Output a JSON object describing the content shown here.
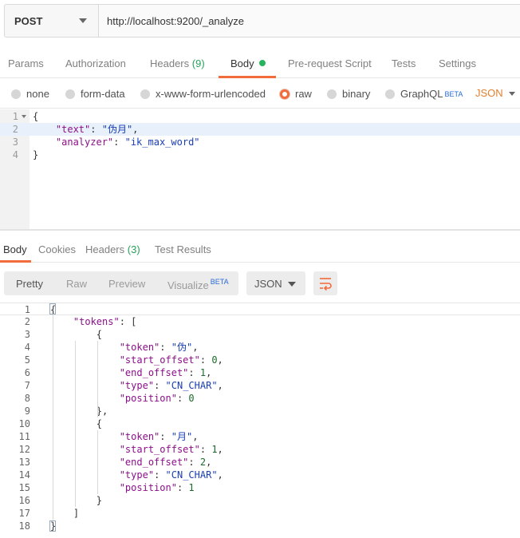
{
  "request": {
    "method": "POST",
    "url": "http://localhost:9200/_analyze"
  },
  "request_tabs": [
    {
      "label": "Params",
      "count": ""
    },
    {
      "label": "Authorization",
      "count": ""
    },
    {
      "label": "Headers",
      "count": "(9)"
    },
    {
      "label": "Body",
      "count": ""
    },
    {
      "label": "Pre-request Script",
      "count": ""
    },
    {
      "label": "Tests",
      "count": ""
    },
    {
      "label": "Settings",
      "count": ""
    }
  ],
  "active_request_tab": "Body",
  "body_types": [
    {
      "label": "none",
      "checked": false
    },
    {
      "label": "form-data",
      "checked": false
    },
    {
      "label": "x-www-form-urlencoded",
      "checked": false
    },
    {
      "label": "raw",
      "checked": true
    },
    {
      "label": "binary",
      "checked": false
    },
    {
      "label": "GraphQL",
      "checked": false,
      "badge": "BETA"
    }
  ],
  "raw_format": "JSON",
  "request_body": {
    "line_numbers": [
      "1",
      "2",
      "3",
      "4"
    ],
    "lines": [
      [
        {
          "t": "p",
          "v": "{"
        }
      ],
      [
        {
          "t": "p",
          "v": "    "
        },
        {
          "t": "k",
          "v": "\"text\""
        },
        {
          "t": "p",
          "v": ": "
        },
        {
          "t": "s",
          "v": "\"伪月\""
        },
        {
          "t": "p",
          "v": ","
        }
      ],
      [
        {
          "t": "p",
          "v": "    "
        },
        {
          "t": "k",
          "v": "\"analyzer\""
        },
        {
          "t": "p",
          "v": ": "
        },
        {
          "t": "s",
          "v": "\"ik_max_word\""
        }
      ],
      [
        {
          "t": "p",
          "v": "}"
        }
      ]
    ]
  },
  "response_tabs": [
    {
      "label": "Body",
      "count": ""
    },
    {
      "label": "Cookies",
      "count": ""
    },
    {
      "label": "Headers",
      "count": "(3)"
    },
    {
      "label": "Test Results",
      "count": ""
    }
  ],
  "active_response_tab": "Body",
  "view_modes": [
    {
      "label": "Pretty",
      "badge": ""
    },
    {
      "label": "Raw",
      "badge": ""
    },
    {
      "label": "Preview",
      "badge": ""
    },
    {
      "label": "Visualize",
      "badge": "BETA"
    }
  ],
  "active_view_mode": "Pretty",
  "response_format": "JSON",
  "icons": {
    "method_caret": "chevron-down-icon",
    "wrap": "wrap-lines-icon",
    "dirty": "modified-dot-icon"
  },
  "colors": {
    "accent": "#f26b3a",
    "dot": "#26b55e",
    "key": "#8c0f8a",
    "string": "#1a3eb5",
    "number": "#1b6b2a",
    "json_label": "#e0812f",
    "beta": "#2a6bd8"
  },
  "response_body": {
    "line_numbers": [
      "1",
      "2",
      "3",
      "4",
      "5",
      "6",
      "7",
      "8",
      "9",
      "10",
      "11",
      "12",
      "13",
      "14",
      "15",
      "16",
      "17",
      "18"
    ],
    "lines": [
      [
        {
          "t": "p",
          "v": "{"
        }
      ],
      [
        {
          "t": "p",
          "v": "    "
        },
        {
          "t": "k",
          "v": "\"tokens\""
        },
        {
          "t": "p",
          "v": ": ["
        }
      ],
      [
        {
          "t": "p",
          "v": "        {"
        }
      ],
      [
        {
          "t": "p",
          "v": "            "
        },
        {
          "t": "k",
          "v": "\"token\""
        },
        {
          "t": "p",
          "v": ": "
        },
        {
          "t": "s",
          "v": "\"伪\""
        },
        {
          "t": "p",
          "v": ","
        }
      ],
      [
        {
          "t": "p",
          "v": "            "
        },
        {
          "t": "k",
          "v": "\"start_offset\""
        },
        {
          "t": "p",
          "v": ": "
        },
        {
          "t": "n",
          "v": "0"
        },
        {
          "t": "p",
          "v": ","
        }
      ],
      [
        {
          "t": "p",
          "v": "            "
        },
        {
          "t": "k",
          "v": "\"end_offset\""
        },
        {
          "t": "p",
          "v": ": "
        },
        {
          "t": "n",
          "v": "1"
        },
        {
          "t": "p",
          "v": ","
        }
      ],
      [
        {
          "t": "p",
          "v": "            "
        },
        {
          "t": "k",
          "v": "\"type\""
        },
        {
          "t": "p",
          "v": ": "
        },
        {
          "t": "s",
          "v": "\"CN_CHAR\""
        },
        {
          "t": "p",
          "v": ","
        }
      ],
      [
        {
          "t": "p",
          "v": "            "
        },
        {
          "t": "k",
          "v": "\"position\""
        },
        {
          "t": "p",
          "v": ": "
        },
        {
          "t": "n",
          "v": "0"
        }
      ],
      [
        {
          "t": "p",
          "v": "        },"
        }
      ],
      [
        {
          "t": "p",
          "v": "        {"
        }
      ],
      [
        {
          "t": "p",
          "v": "            "
        },
        {
          "t": "k",
          "v": "\"token\""
        },
        {
          "t": "p",
          "v": ": "
        },
        {
          "t": "s",
          "v": "\"月\""
        },
        {
          "t": "p",
          "v": ","
        }
      ],
      [
        {
          "t": "p",
          "v": "            "
        },
        {
          "t": "k",
          "v": "\"start_offset\""
        },
        {
          "t": "p",
          "v": ": "
        },
        {
          "t": "n",
          "v": "1"
        },
        {
          "t": "p",
          "v": ","
        }
      ],
      [
        {
          "t": "p",
          "v": "            "
        },
        {
          "t": "k",
          "v": "\"end_offset\""
        },
        {
          "t": "p",
          "v": ": "
        },
        {
          "t": "n",
          "v": "2"
        },
        {
          "t": "p",
          "v": ","
        }
      ],
      [
        {
          "t": "p",
          "v": "            "
        },
        {
          "t": "k",
          "v": "\"type\""
        },
        {
          "t": "p",
          "v": ": "
        },
        {
          "t": "s",
          "v": "\"CN_CHAR\""
        },
        {
          "t": "p",
          "v": ","
        }
      ],
      [
        {
          "t": "p",
          "v": "            "
        },
        {
          "t": "k",
          "v": "\"position\""
        },
        {
          "t": "p",
          "v": ": "
        },
        {
          "t": "n",
          "v": "1"
        }
      ],
      [
        {
          "t": "p",
          "v": "        }"
        }
      ],
      [
        {
          "t": "p",
          "v": "    ]"
        }
      ],
      [
        {
          "t": "p",
          "v": "}"
        }
      ]
    ]
  }
}
